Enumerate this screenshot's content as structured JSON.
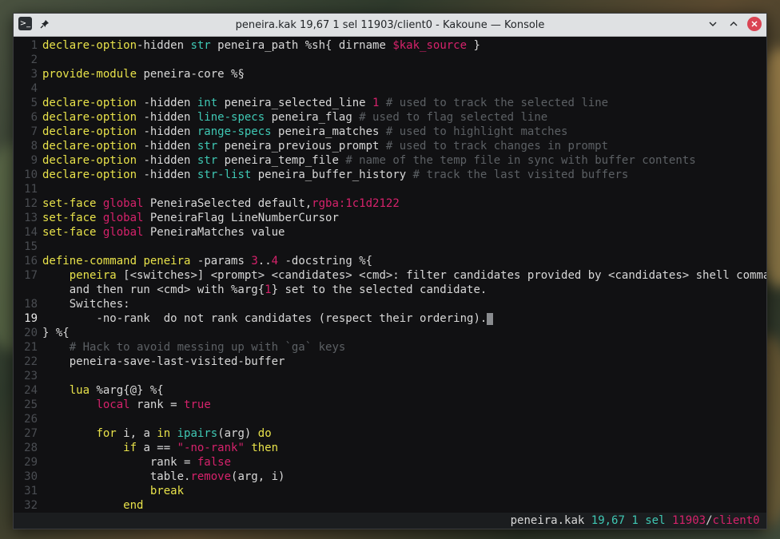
{
  "window": {
    "title": "peneira.kak 19,67 1 sel 11903/client0 - Kakoune — Konsole"
  },
  "lines": [
    {
      "n": "1",
      "tokens": [
        [
          "kw",
          "declare-option"
        ],
        [
          "",
          "-hidden "
        ],
        [
          "ty",
          "str"
        ],
        [
          "",
          " peneira_path %sh{ dirname "
        ],
        [
          "str",
          "$kak_source"
        ],
        [
          "",
          " }"
        ]
      ]
    },
    {
      "n": "2",
      "tokens": []
    },
    {
      "n": "3",
      "tokens": [
        [
          "kw",
          "provide-module"
        ],
        [
          "",
          " peneira-core %§"
        ]
      ]
    },
    {
      "n": "4",
      "tokens": []
    },
    {
      "n": "5",
      "tokens": [
        [
          "kw",
          "declare-option"
        ],
        [
          "",
          " -hidden "
        ],
        [
          "ty",
          "int"
        ],
        [
          "",
          " peneira_selected_line "
        ],
        [
          "num",
          "1"
        ],
        [
          "",
          " "
        ],
        [
          "cm",
          "# used to track the selected line"
        ]
      ]
    },
    {
      "n": "6",
      "tokens": [
        [
          "kw",
          "declare-option"
        ],
        [
          "",
          " -hidden "
        ],
        [
          "ty",
          "line-specs"
        ],
        [
          "",
          " peneira_flag "
        ],
        [
          "cm",
          "# used to flag selected line"
        ]
      ]
    },
    {
      "n": "7",
      "tokens": [
        [
          "kw",
          "declare-option"
        ],
        [
          "",
          " -hidden "
        ],
        [
          "ty",
          "range-specs"
        ],
        [
          "",
          " peneira_matches "
        ],
        [
          "cm",
          "# used to highlight matches"
        ]
      ]
    },
    {
      "n": "8",
      "tokens": [
        [
          "kw",
          "declare-option"
        ],
        [
          "",
          " -hidden "
        ],
        [
          "ty",
          "str"
        ],
        [
          "",
          " peneira_previous_prompt "
        ],
        [
          "cm",
          "# used to track changes in prompt"
        ]
      ]
    },
    {
      "n": "9",
      "tokens": [
        [
          "kw",
          "declare-option"
        ],
        [
          "",
          " -hidden "
        ],
        [
          "ty",
          "str"
        ],
        [
          "",
          " peneira_temp_file "
        ],
        [
          "cm",
          "# name of the temp file in sync with buffer contents"
        ]
      ]
    },
    {
      "n": "10",
      "tokens": [
        [
          "kw",
          "declare-option"
        ],
        [
          "",
          " -hidden "
        ],
        [
          "ty",
          "str-list"
        ],
        [
          "",
          " peneira_buffer_history "
        ],
        [
          "cm",
          "# track the last visited buffers"
        ]
      ]
    },
    {
      "n": "11",
      "tokens": []
    },
    {
      "n": "12",
      "tokens": [
        [
          "kw",
          "set-face"
        ],
        [
          "",
          " "
        ],
        [
          "str",
          "global"
        ],
        [
          "",
          " PeneiraSelected default,"
        ],
        [
          "str",
          "rgba:1c1d2122"
        ]
      ]
    },
    {
      "n": "13",
      "tokens": [
        [
          "kw",
          "set-face"
        ],
        [
          "",
          " "
        ],
        [
          "str",
          "global"
        ],
        [
          "",
          " PeneiraFlag LineNumberCursor"
        ]
      ]
    },
    {
      "n": "14",
      "tokens": [
        [
          "kw",
          "set-face"
        ],
        [
          "",
          " "
        ],
        [
          "str",
          "global"
        ],
        [
          "",
          " PeneiraMatches value"
        ]
      ]
    },
    {
      "n": "15",
      "tokens": []
    },
    {
      "n": "16",
      "tokens": [
        [
          "kw",
          "define-command"
        ],
        [
          "",
          " "
        ],
        [
          "kw",
          "peneira"
        ],
        [
          "",
          " -params "
        ],
        [
          "num",
          "3"
        ],
        [
          "",
          ".."
        ],
        [
          "num",
          "4"
        ],
        [
          "",
          " -docstring %{"
        ]
      ]
    },
    {
      "n": "17",
      "tokens": [
        [
          "",
          "    "
        ],
        [
          "kw",
          "peneira"
        ],
        [
          "",
          " [<switches>] <prompt> <candidates> <cmd>: filter candidates provided by <candidates> shell command"
        ]
      ]
    },
    {
      "n": "",
      "tokens": [
        [
          "",
          "    and then run <cmd> with %arg{"
        ],
        [
          "num",
          "1"
        ],
        [
          "",
          "} set to the selected candidate."
        ]
      ]
    },
    {
      "n": "18",
      "tokens": [
        [
          "",
          "    Switches:"
        ]
      ]
    },
    {
      "n": "19",
      "cur": true,
      "tokens": [
        [
          "",
          "        -no-rank  do not rank candidates (respect their ordering)."
        ],
        [
          "cursor",
          ""
        ]
      ]
    },
    {
      "n": "20",
      "tokens": [
        [
          "",
          "} %{"
        ]
      ]
    },
    {
      "n": "21",
      "tokens": [
        [
          "",
          "    "
        ],
        [
          "cm",
          "# Hack to avoid messing up with `ga` keys"
        ]
      ]
    },
    {
      "n": "22",
      "tokens": [
        [
          "",
          "    peneira-save-last-visited-buffer"
        ]
      ]
    },
    {
      "n": "23",
      "tokens": []
    },
    {
      "n": "24",
      "tokens": [
        [
          "",
          "    "
        ],
        [
          "lua-fn",
          "lua"
        ],
        [
          "",
          " %arg{@} %{"
        ]
      ]
    },
    {
      "n": "25",
      "tokens": [
        [
          "",
          "        "
        ],
        [
          "lua-kw",
          "local"
        ],
        [
          "",
          " rank = "
        ],
        [
          "lua-kw",
          "true"
        ]
      ]
    },
    {
      "n": "26",
      "tokens": []
    },
    {
      "n": "27",
      "tokens": [
        [
          "",
          "        "
        ],
        [
          "lua-fn",
          "for"
        ],
        [
          "",
          " i, a "
        ],
        [
          "lua-fn",
          "in"
        ],
        [
          "",
          " "
        ],
        [
          "ty",
          "ipairs"
        ],
        [
          "",
          "(arg) "
        ],
        [
          "lua-fn",
          "do"
        ]
      ]
    },
    {
      "n": "28",
      "tokens": [
        [
          "",
          "            "
        ],
        [
          "lua-fn",
          "if"
        ],
        [
          "",
          " a == "
        ],
        [
          "str",
          "\"-no-rank\""
        ],
        [
          "",
          " "
        ],
        [
          "lua-fn",
          "then"
        ]
      ]
    },
    {
      "n": "29",
      "tokens": [
        [
          "",
          "                rank = "
        ],
        [
          "lua-kw",
          "false"
        ]
      ]
    },
    {
      "n": "30",
      "tokens": [
        [
          "",
          "                table."
        ],
        [
          "mth",
          "remove"
        ],
        [
          "",
          "(arg, i)"
        ]
      ]
    },
    {
      "n": "31",
      "tokens": [
        [
          "",
          "                "
        ],
        [
          "lua-fn",
          "break"
        ]
      ]
    },
    {
      "n": "32",
      "tokens": [
        [
          "",
          "            "
        ],
        [
          "lua-fn",
          "end"
        ]
      ]
    }
  ],
  "status": {
    "file": "peneira.kak",
    "pos": "19,67",
    "sel": "1 sel",
    "timestamp": "11903",
    "sep": "/",
    "client": "client0"
  },
  "icons": {
    "app": "terminal-icon",
    "pin": "pin-icon",
    "collapse": "chevron-down-icon",
    "maximize": "chevron-up-icon",
    "close": "close-icon"
  },
  "colors": {
    "keyword": "#e8e24a",
    "type": "#3fc8b4",
    "comment": "#5c6064",
    "literal": "#d6226b",
    "close_button": "#da4453"
  }
}
